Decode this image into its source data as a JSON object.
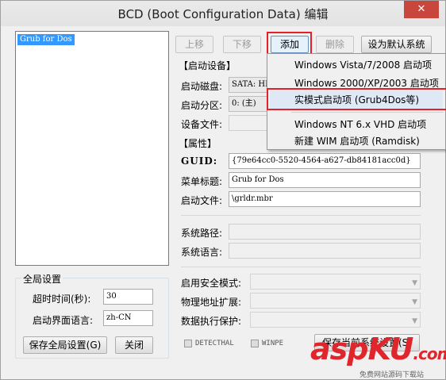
{
  "window": {
    "title": "BCD (Boot Configuration Data) 编辑",
    "close_glyph": "✕"
  },
  "list": {
    "items": [
      "Grub for Dos"
    ]
  },
  "toolbar": {
    "up": "上移",
    "down": "下移",
    "add": "添加",
    "delete": "删除",
    "set_default": "设为默认系统"
  },
  "boot_device": {
    "title": "【启动设备】",
    "disk_label": "启动磁盘:",
    "disk_value": "SATA: HD",
    "partition_label": "启动分区:",
    "partition_value": "0: (主)",
    "device_file_label": "设备文件:",
    "device_file_value": ""
  },
  "properties": {
    "title": "【属性】",
    "guid_label": "GUID:",
    "guid_value": "{79e64cc0-5520-4564-a627-db84181acc0d}",
    "menu_title_label": "菜单标题:",
    "menu_title_value": "Grub for Dos",
    "boot_file_label": "启动文件:",
    "boot_file_value": "\\grldr.mbr",
    "system_path_label": "系统路径:",
    "system_path_value": "",
    "system_lang_label": "系统语言:",
    "system_lang_value": ""
  },
  "advanced": {
    "safe_mode_label": "启用安全模式:",
    "pae_label": "物理地址扩展:",
    "dep_label": "数据执行保护:",
    "detecthal": "DETECTHAL",
    "winpe": "WINPE",
    "save_current": "保存当前系统设置(S)"
  },
  "global": {
    "title": "全局设置",
    "timeout_label": "超时时间(秒):",
    "timeout_value": "30",
    "ui_lang_label": "启动界面语言:",
    "ui_lang_value": "zh-CN",
    "save_global": "保存全局设置(G)",
    "close": "关闭"
  },
  "add_menu": {
    "items": [
      "Windows Vista/7/2008 启动项",
      "Windows 2000/XP/2003 启动项",
      "实模式启动项 (Grub4Dos等)",
      "Windows NT 6.x VHD 启动项",
      "新建 WIM 启动项 (Ramdisk)"
    ],
    "highlighted_index": 2
  },
  "watermark": {
    "main": "asp",
    "accent": "KU",
    "suffix": ".com",
    "sub": "免费网站源码下载站"
  },
  "colors": {
    "highlight_box": "#e4202a",
    "selection": "#3399ff",
    "watermark": "#e0262d"
  }
}
